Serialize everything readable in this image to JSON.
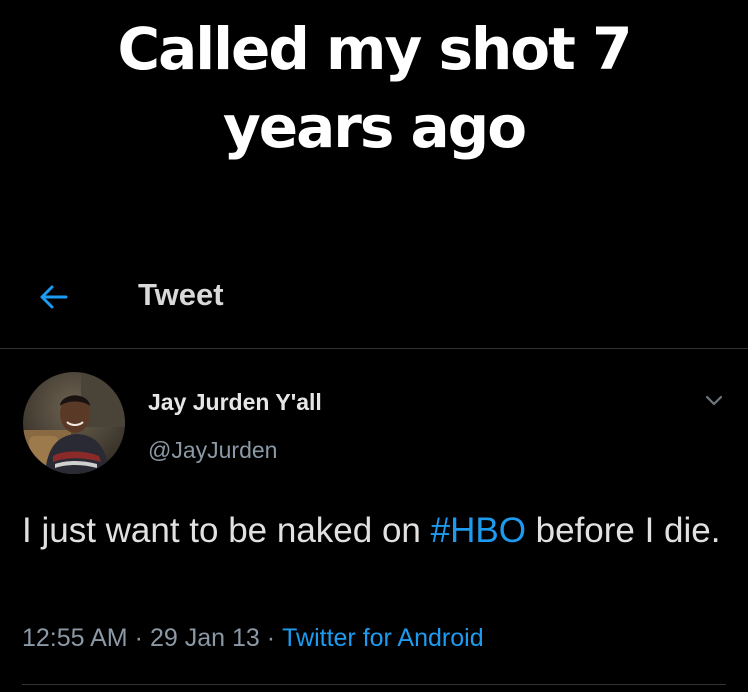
{
  "caption": {
    "line1": "Called my shot 7",
    "line2": "years ago"
  },
  "header": {
    "back_icon": "arrow-left-icon",
    "title": "Tweet"
  },
  "tweet": {
    "avatar_icon": "profile-avatar",
    "display_name": "Jay Jurden Y'all",
    "handle": "@JayJurden",
    "menu_icon": "chevron-down-icon",
    "text_before": "I just want to be naked on ",
    "hashtag": "#HBO",
    "text_after": " before I die.",
    "time": "12:55 AM",
    "date": "29 Jan 13",
    "separator": "·",
    "source": "Twitter for Android"
  },
  "colors": {
    "background": "#000000",
    "accent": "#1d9bf0",
    "secondary_text": "#8b98a5",
    "divider": "#2f3336"
  }
}
